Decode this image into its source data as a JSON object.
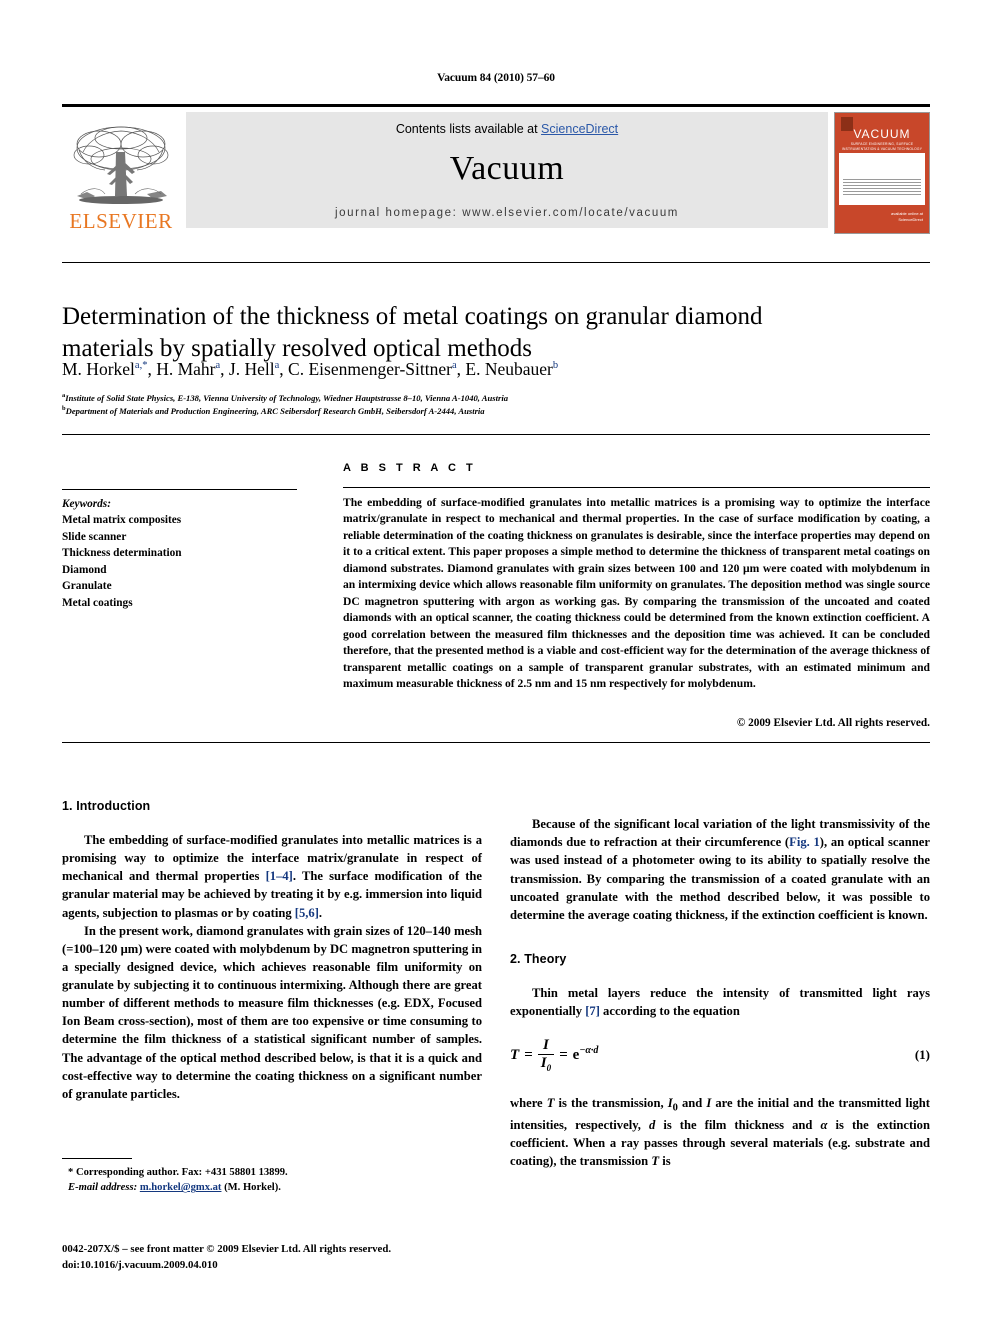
{
  "running_head": "Vacuum 84 (2010) 57–60",
  "masthead": {
    "publisher_name": "ELSEVIER",
    "publisher_logo_icon": "elsevier-tree-icon",
    "contents_prefix": "Contents lists available at ",
    "contents_link": "ScienceDirect",
    "journal_title": "Vacuum",
    "homepage_line": "journal homepage: www.elsevier.com/locate/vacuum",
    "cover": {
      "title": "VACUUM",
      "subtitle": "SURFACE ENGINEERING, SURFACE INSTRUMENTATION & VACUUM TECHNOLOGY",
      "service_label": "available online at",
      "service_name": "ScienceDirect"
    }
  },
  "article": {
    "title": "Determination of the thickness of metal coatings on granular diamond materials by spatially resolved optical methods",
    "authors_html": "M. Horkel<sup>a,*</sup>, H. Mahr<sup>a</sup>, J. Hell<sup>a</sup>, C. Eisenmenger-Sittner<sup>a</sup>, E. Neubauer<sup>b</sup>",
    "affiliation_a": "Institute of Solid State Physics, E-138, Vienna University of Technology, Wiedner Hauptstrasse 8–10, Vienna A-1040, Austria",
    "affiliation_b": "Department of Materials and Production Engineering, ARC Seibersdorf Research GmbH, Seibersdorf A-2444, Austria"
  },
  "keywords": {
    "heading": "Keywords:",
    "items": [
      "Metal matrix composites",
      "Slide scanner",
      "Thickness determination",
      "Diamond",
      "Granulate",
      "Metal coatings"
    ]
  },
  "abstract": {
    "label": "A B S T R A C T",
    "text": "The embedding of surface-modified granulates into metallic matrices is a promising way to optimize the interface matrix/granulate in respect to mechanical and thermal properties. In the case of surface modification by coating, a reliable determination of the coating thickness on granulates is desirable, since the interface properties may depend on it to a critical extent. This paper proposes a simple method to determine the thickness of transparent metal coatings on diamond substrates. Diamond granulates with grain sizes between 100 and 120 μm were coated with molybdenum in an intermixing device which allows reasonable film uniformity on granulates. The deposition method was single source DC magnetron sputtering with argon as working gas. By comparing the transmission of the uncoated and coated diamonds with an optical scanner, the coating thickness could be determined from the known extinction coefficient. A good correlation between the measured film thicknesses and the deposition time was achieved. It can be concluded therefore, that the presented method is a viable and cost-efficient way for the determination of the average thickness of transparent metallic coatings on a sample of transparent granular substrates, with an estimated minimum and maximum measurable thickness of 2.5 nm and 15 nm respectively for molybdenum.",
    "copyright": "© 2009 Elsevier Ltd. All rights reserved."
  },
  "sections": {
    "introduction": {
      "heading": "1. Introduction",
      "p1_a": "The embedding of surface-modified granulates into metallic matrices is a promising way to optimize the interface matrix/granulate in respect of mechanical and thermal properties ",
      "p1_ref1": "[1–4]",
      "p1_b": ". The surface modification of the granular material may be achieved by treating it by e.g. immersion into liquid agents, subjection to plasmas or by coating ",
      "p1_ref2": "[5,6]",
      "p1_c": ".",
      "p2": "In the present work, diamond granulates with grain sizes of 120–140 mesh (=100–120 μm) were coated with molybdenum by DC magnetron sputtering in a specially designed device, which achieves reasonable film uniformity on granulate by subjecting it to continuous intermixing. Although there are great number of different methods to measure film thicknesses (e.g. EDX, Focused Ion Beam cross-section), most of them are too expensive or time consuming to determine the film thickness of a statistical significant number of samples. The advantage of the optical method described below, is that it is a quick and cost-effective way to determine the coating thickness on a significant number of granulate particles.",
      "p3_a": "Because of the significant local variation of the light transmissivity of the diamonds due to refraction at their circumference (",
      "p3_figref": "Fig. 1",
      "p3_b": "), an optical scanner was used instead of a photometer owing to its ability to spatially resolve the transmission. By comparing the transmission of a coated granulate with an uncoated granulate with the method described below, it was possible to determine the average coating thickness, if the extinction coefficient is known."
    },
    "theory": {
      "heading": "2. Theory",
      "p1_a": "Thin metal layers reduce the intensity of transmitted light rays exponentially ",
      "p1_ref": "[7]",
      "p1_b": " according to the equation",
      "equation": {
        "lhs": "T",
        "eq1": "=",
        "numerator": "I",
        "denominator": "I0",
        "eq2": "=",
        "rhs": "e",
        "exponent": "−α·d",
        "number": "(1)"
      },
      "p2_html": "where <i>T</i> is the transmission, <i>I</i><sub>0</sub> and <i>I</i> are the initial and the transmitted light intensities, respectively, <i>d</i> is the film thickness and <i>α</i> is the extinction coefficient. When a ray passes through several materials (e.g. substrate and coating), the transmission <i>T</i> is"
    }
  },
  "footnotes": {
    "corresponding": "* Corresponding author. Fax: +431 58801 13899.",
    "email_label": "E-mail address: ",
    "email_link": "m.horkel@gmx.at",
    "email_suffix": " (M. Horkel).",
    "issn_line": "0042-207X/$ – see front matter © 2009 Elsevier Ltd. All rights reserved.",
    "doi_line": "doi:10.1016/j.vacuum.2009.04.010"
  },
  "colors": {
    "link": "#14387f",
    "sciencedirect": "#2b58a8",
    "elsevier_orange": "#E87722",
    "cover_orange": "#c8472a",
    "band_gray": "#e6e6e6"
  }
}
